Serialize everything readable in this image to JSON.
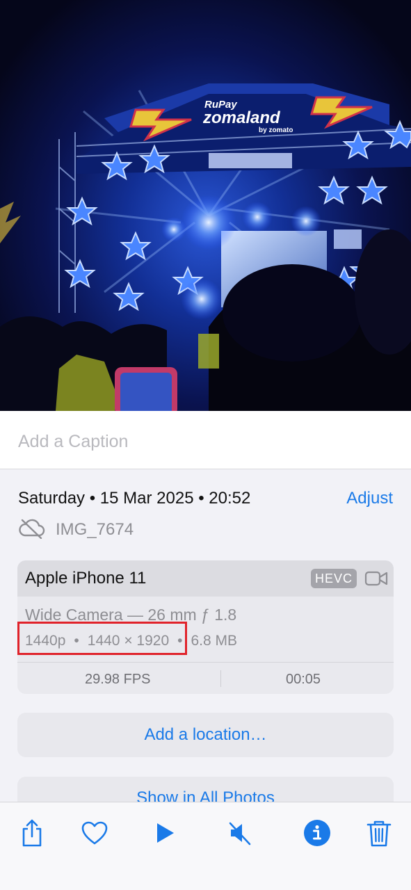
{
  "photo": {
    "stage_brand_top": "RuPay",
    "stage_brand_main": "zomaland",
    "stage_brand_sub": "by zomato"
  },
  "caption": {
    "placeholder": "Add a Caption"
  },
  "info": {
    "date_time": "Saturday • 15 Mar 2025 • 20:52",
    "adjust_label": "Adjust",
    "file_name": "IMG_7674",
    "cloud_icon": "cloud-slash-icon"
  },
  "card": {
    "device": "Apple iPhone 11",
    "format_badge": "HEVC",
    "media_icon": "video-camera-icon",
    "lens": "Wide Camera — 26 mm ƒ 1.8",
    "resolution_label": "1440p",
    "dimensions": "1440 × 1920",
    "file_size": "6.8 MB",
    "fps": "29.98 FPS",
    "duration": "00:05",
    "highlight_color": "#e0222a"
  },
  "actions": {
    "location_label": "Add a location…",
    "all_photos_label": "Show in All Photos"
  },
  "toolbar": {
    "items": [
      "share-icon",
      "heart-icon",
      "play-icon",
      "speaker-muted-icon",
      "info-icon",
      "trash-icon"
    ]
  },
  "colors": {
    "accent": "#1a7ae8",
    "background": "#f2f2f7",
    "secondary_text": "#8e8e93"
  }
}
